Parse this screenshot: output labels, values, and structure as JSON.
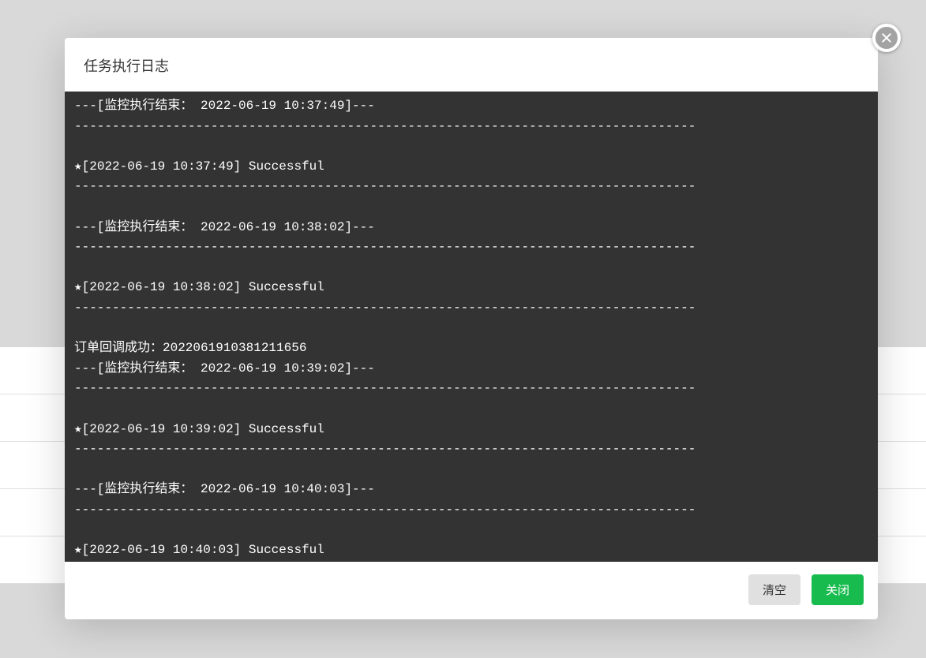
{
  "modal": {
    "title": "任务执行日志",
    "divider": "----------------------------------------------------------------------------------",
    "logs": [
      "---[监控执行结束： 2022-06-19 10:37:49]---",
      "----------------------------------------------------------------------------------",
      "",
      "★[2022-06-19 10:37:49] Successful",
      "----------------------------------------------------------------------------------",
      "",
      "---[监控执行结束： 2022-06-19 10:38:02]---",
      "----------------------------------------------------------------------------------",
      "",
      "★[2022-06-19 10:38:02] Successful",
      "----------------------------------------------------------------------------------",
      "",
      "订单回调成功：202206191038121​1656",
      "---[监控执行结束： 2022-06-19 10:39:02]---",
      "----------------------------------------------------------------------------------",
      "",
      "★[2022-06-19 10:39:02] Successful",
      "----------------------------------------------------------------------------------",
      "",
      "---[监控执行结束： 2022-06-19 10:40:03]---",
      "----------------------------------------------------------------------------------",
      "",
      "★[2022-06-19 10:40:03] Successful",
      "----------------------------------------------------------------------------------",
      ""
    ],
    "buttons": {
      "clear": "清空",
      "close": "关闭"
    }
  }
}
